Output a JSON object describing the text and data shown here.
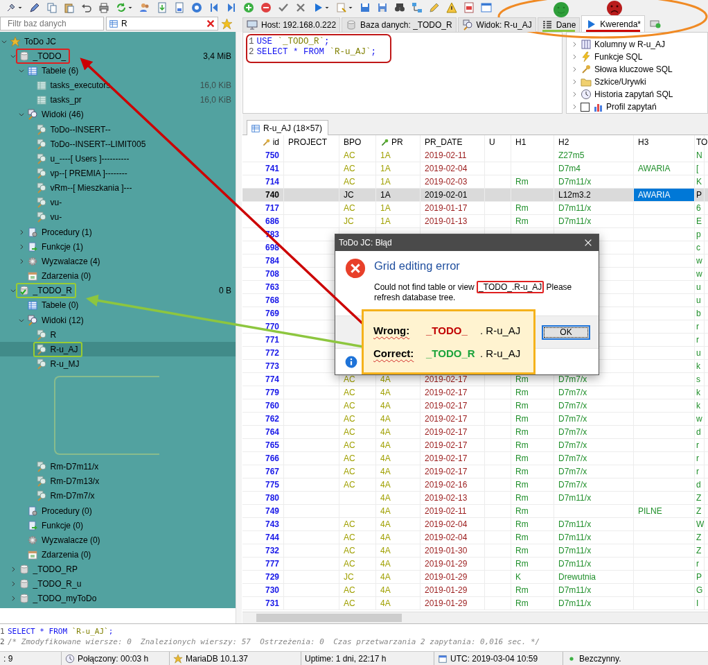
{
  "filters": {
    "database_filter": {
      "placeholder": "Filtr baz danych"
    },
    "table_filter": {
      "value": "R"
    }
  },
  "tabs": [
    {
      "label": "Host: 192.168.0.222",
      "kind": "host",
      "selected": false
    },
    {
      "label": "Baza danych: _TODO_R",
      "kind": "database",
      "selected": false
    },
    {
      "label": "Widok: R-u_AJ",
      "kind": "view",
      "selected": false
    },
    {
      "label": "Dane",
      "kind": "data",
      "selected": false,
      "color": "#8dc63f"
    },
    {
      "label": "Kwerenda*",
      "kind": "query",
      "selected": true,
      "color": "#cc0000"
    }
  ],
  "tree": [
    {
      "label": "ToDo JC",
      "kind": "server",
      "expanded": true,
      "selected": false,
      "children": [
        {
          "label": "_TODO_",
          "kind": "database",
          "size": "3,4 MiB",
          "active": false,
          "color": "#e02020",
          "expanded": true,
          "selected": false,
          "children": [
            {
              "label": "Tabele (6)",
              "kind": "tables",
              "expanded": true,
              "selected": false,
              "children": [
                {
                  "label": "tasks_executors",
                  "kind": "table",
                  "size": "16,0 KiB",
                  "selected": false
                },
                {
                  "label": "tasks_pr",
                  "kind": "table",
                  "size": "16,0 KiB",
                  "selected": false
                }
              ]
            },
            {
              "label": "Widoki (46)",
              "kind": "views",
              "expanded": true,
              "selected": false,
              "children": [
                {
                  "label": "ToDo--INSERT--",
                  "kind": "view",
                  "selected": false
                },
                {
                  "label": "ToDo--INSERT--LIMIT005",
                  "kind": "view",
                  "selected": false
                },
                {
                  "label": "u_----[ Users ]----------",
                  "kind": "view",
                  "selected": false
                },
                {
                  "label": "vp--[ PREMIA ]--------",
                  "kind": "view",
                  "selected": false
                },
                {
                  "label": "vRm--[ Mieszkania ]---",
                  "kind": "view",
                  "selected": false
                },
                {
                  "label": "vu-",
                  "kind": "view",
                  "selected": false
                },
                {
                  "label": "vu-",
                  "kind": "view",
                  "selected": false
                }
              ]
            },
            {
              "label": "Procedury (1)",
              "kind": "procedures",
              "expanded": false,
              "selected": false
            },
            {
              "label": "Funkcje (1)",
              "kind": "functions",
              "expanded": false,
              "selected": false
            },
            {
              "label": "Wyzwalacze (4)",
              "kind": "triggers",
              "expanded": false,
              "selected": false
            },
            {
              "label": "Zdarzenia (0)",
              "kind": "events",
              "selected": false
            }
          ]
        },
        {
          "label": "_TODO_R",
          "kind": "database",
          "size": "0 B",
          "active": true,
          "color": "#9acd32",
          "expanded": true,
          "selected": false,
          "children": [
            {
              "label": "Tabele (0)",
              "kind": "tables",
              "selected": false
            },
            {
              "label": "Widoki (12)",
              "kind": "views",
              "expanded": true,
              "selected": false,
              "children": [
                {
                  "label": "R",
                  "kind": "view",
                  "selected": false
                },
                {
                  "label": "R-u_AJ",
                  "kind": "view",
                  "selected": true,
                  "color": "#9acd32"
                },
                {
                  "label": "R-u_MJ",
                  "kind": "view",
                  "selected": false
                },
                {
                  "kind": "redacted"
                },
                {
                  "label": "Rm-D7m11/x",
                  "kind": "view",
                  "selected": false
                },
                {
                  "label": "Rm-D7m13/x",
                  "kind": "view",
                  "selected": false
                },
                {
                  "label": "Rm-D7m7/x",
                  "kind": "view",
                  "selected": false
                }
              ]
            },
            {
              "label": "Procedury (0)",
              "kind": "procedures",
              "selected": false
            },
            {
              "label": "Funkcje (0)",
              "kind": "functions",
              "selected": false
            },
            {
              "label": "Wyzwalacze (0)",
              "kind": "triggers",
              "selected": false
            },
            {
              "label": "Zdarzenia (0)",
              "kind": "events",
              "selected": false
            }
          ]
        },
        {
          "label": "_TODO_RP",
          "kind": "database",
          "active": false,
          "expanded": false,
          "selected": false
        },
        {
          "label": "_TODO_R_u",
          "kind": "database",
          "active": false,
          "expanded": false,
          "selected": false
        },
        {
          "label": "_TODO_myToDo",
          "kind": "database",
          "active": false,
          "expanded": false,
          "selected": false
        }
      ]
    }
  ],
  "editor": {
    "lines": [
      {
        "number": "1",
        "tokens": [
          {
            "kind": "keyword",
            "text": "USE "
          },
          {
            "kind": "string",
            "text": "`_TODO_R`"
          },
          {
            "kind": "punct",
            "text": ";"
          }
        ]
      },
      {
        "number": "2",
        "tokens": [
          {
            "kind": "keyword",
            "text": "SELECT * FROM "
          },
          {
            "kind": "string",
            "text": "`R-u_AJ`"
          },
          {
            "kind": "punct",
            "text": ";"
          }
        ]
      }
    ]
  },
  "helpers": [
    {
      "label": "Kolumny w R-u_AJ",
      "kind": "columns",
      "expanded": false
    },
    {
      "label": "Funkcje SQL",
      "kind": "functions",
      "expanded": false
    },
    {
      "label": "Słowa kluczowe SQL",
      "kind": "keywords",
      "expanded": false
    },
    {
      "label": "Szkice/Urywki",
      "kind": "snippets",
      "expanded": false
    },
    {
      "label": "Historia zapytań SQL",
      "kind": "history",
      "expanded": false
    },
    {
      "label": "Profil zapytań",
      "kind": "profile",
      "expanded": false,
      "checked": false
    }
  ],
  "result_tabs": [
    {
      "label": "R-u_AJ (18×57)",
      "selected": true
    }
  ],
  "grid": {
    "columns": [
      {
        "label": "id",
        "kind": "primary_key"
      },
      {
        "label": "PROJECT",
        "kind": "plain"
      },
      {
        "label": "BPO",
        "kind": "plain"
      },
      {
        "label": "PR",
        "kind": "foreign_key"
      },
      {
        "label": "PR_DATE",
        "kind": "plain"
      },
      {
        "label": "U",
        "kind": "plain"
      },
      {
        "label": "H1",
        "kind": "plain"
      },
      {
        "label": "H2",
        "kind": "plain"
      },
      {
        "label": "H3",
        "kind": "plain"
      },
      {
        "label": "TO",
        "kind": "plain"
      }
    ],
    "rows": [
      {
        "id": "750",
        "bpo": "AC",
        "pr": "1A",
        "pr_date": "2019-02-11",
        "h2": "Z27m5",
        "column_10": "N",
        "selected": false
      },
      {
        "id": "741",
        "bpo": "AC",
        "pr": "1A",
        "pr_date": "2019-02-04",
        "h2": "D7m4",
        "h3": "AWARIA",
        "column_10": "[",
        "selected": false
      },
      {
        "id": "714",
        "bpo": "AC",
        "pr": "1A",
        "pr_date": "2019-02-03",
        "h1": "Rm",
        "h2": "D7m11/x",
        "column_10": "K",
        "selected": false
      },
      {
        "id": "740",
        "bpo": "JC",
        "pr": "1A",
        "pr_date": "2019-02-01",
        "h2": "L12m3.2",
        "h3": {
          "text": "AWARIA",
          "focused": true
        },
        "column_10": "P",
        "selected": true
      },
      {
        "id": "717",
        "bpo": "AC",
        "pr": "1A",
        "pr_date": "2019-01-17",
        "h1": "Rm",
        "h2": "D7m11/x",
        "column_10": "6",
        "selected": false
      },
      {
        "id": "686",
        "bpo": "JC",
        "pr": "1A",
        "pr_date": "2019-01-13",
        "h1": "Rm",
        "h2": "D7m11/x",
        "column_10": "E",
        "selected": false
      },
      {
        "id": "783",
        "column_10": "p",
        "selected": false
      },
      {
        "id": "698",
        "column_10": "c",
        "selected": false
      },
      {
        "id": "784",
        "column_10": "w",
        "selected": false
      },
      {
        "id": "708",
        "column_10": "w",
        "selected": false
      },
      {
        "id": "763",
        "column_10": "u",
        "selected": false
      },
      {
        "id": "768",
        "column_10": "u",
        "selected": false
      },
      {
        "id": "769",
        "column_10": "b",
        "selected": false
      },
      {
        "id": "770",
        "column_10": "r",
        "selected": false
      },
      {
        "id": "771",
        "column_10": "r",
        "selected": false
      },
      {
        "id": "772",
        "column_10": "u",
        "selected": false
      },
      {
        "id": "773",
        "column_10": "k",
        "selected": false
      },
      {
        "id": "774",
        "bpo": "AC",
        "pr": "4A",
        "pr_date": "2019-02-17",
        "h1": "Rm",
        "h2": "D7m7/x",
        "column_10": "s",
        "selected": false
      },
      {
        "id": "779",
        "bpo": "AC",
        "pr": "4A",
        "pr_date": "2019-02-17",
        "h1": "Rm",
        "h2": "D7m7/x",
        "column_10": "k",
        "selected": false
      },
      {
        "id": "760",
        "bpo": "AC",
        "pr": "4A",
        "pr_date": "2019-02-17",
        "h1": "Rm",
        "h2": "D7m7/x",
        "column_10": "k",
        "selected": false
      },
      {
        "id": "762",
        "bpo": "AC",
        "pr": "4A",
        "pr_date": "2019-02-17",
        "h1": "Rm",
        "h2": "D7m7/x",
        "column_10": "w",
        "selected": false
      },
      {
        "id": "764",
        "bpo": "AC",
        "pr": "4A",
        "pr_date": "2019-02-17",
        "h1": "Rm",
        "h2": "D7m7/x",
        "column_10": "d",
        "selected": false
      },
      {
        "id": "765",
        "bpo": "AC",
        "pr": "4A",
        "pr_date": "2019-02-17",
        "h1": "Rm",
        "h2": "D7m7/x",
        "column_10": "r",
        "selected": false
      },
      {
        "id": "766",
        "bpo": "AC",
        "pr": "4A",
        "pr_date": "2019-02-17",
        "h1": "Rm",
        "h2": "D7m7/x",
        "column_10": "r",
        "selected": false
      },
      {
        "id": "767",
        "bpo": "AC",
        "pr": "4A",
        "pr_date": "2019-02-17",
        "h1": "Rm",
        "h2": "D7m7/x",
        "column_10": "r",
        "selected": false
      },
      {
        "id": "775",
        "bpo": "AC",
        "pr": "4A",
        "pr_date": "2019-02-16",
        "h1": "Rm",
        "h2": "D7m7/x",
        "column_10": "d",
        "selected": false
      },
      {
        "id": "780",
        "pr": "4A",
        "pr_date": "2019-02-13",
        "h1": "Rm",
        "h2": "D7m11/x",
        "column_10": "Z",
        "selected": false
      },
      {
        "id": "749",
        "pr": "4A",
        "pr_date": "2019-02-11",
        "h1": "Rm",
        "h3": "PILNE",
        "column_10": "Z",
        "selected": false
      },
      {
        "id": "743",
        "bpo": "AC",
        "pr": "4A",
        "pr_date": "2019-02-04",
        "h1": "Rm",
        "h2": "D7m11/x",
        "column_10": "W",
        "selected": false
      },
      {
        "id": "744",
        "bpo": "AC",
        "pr": "4A",
        "pr_date": "2019-02-04",
        "h1": "Rm",
        "h2": "D7m11/x",
        "column_10": "Z",
        "selected": false
      },
      {
        "id": "732",
        "bpo": "AC",
        "pr": "4A",
        "pr_date": "2019-01-30",
        "h1": "Rm",
        "h2": "D7m11/x",
        "column_10": "Z",
        "selected": false
      },
      {
        "id": "777",
        "bpo": "AC",
        "pr": "4A",
        "pr_date": "2019-01-29",
        "h1": "Rm",
        "h2": "D7m11/x",
        "column_10": "r",
        "selected": false
      },
      {
        "id": "729",
        "bpo": "JC",
        "pr": "4A",
        "pr_date": "2019-01-29",
        "h1": "K",
        "h2": "Drewutnia",
        "column_10": "P",
        "selected": false
      },
      {
        "id": "730",
        "bpo": "AC",
        "pr": "4A",
        "pr_date": "2019-01-29",
        "h1": "Rm",
        "h2": "D7m11/x",
        "column_10": "G",
        "selected": false
      },
      {
        "id": "731",
        "bpo": "AC",
        "pr": "4A",
        "pr_date": "2019-01-29",
        "h1": "Rm",
        "h2": "D7m11/x",
        "column_10": "I",
        "selected": false
      }
    ]
  },
  "dialog": {
    "title": "ToDo JC: Błąd",
    "heading": "Grid editing error",
    "message": {
      "before": "Could not find table or view",
      "highlight": "_TODO_.R-u_AJ",
      "after": "Please refresh database tree."
    },
    "button": {
      "label": "OK",
      "focused": true
    }
  },
  "annotation": {
    "lines": [
      {
        "kind": "wrong",
        "label": "Wrong:",
        "database": "_TODO_",
        "object": ". R-u_AJ"
      },
      {
        "kind": "correct",
        "label": "Correct:",
        "database": "_TODO_R",
        "object": ". R-u_AJ"
      }
    ]
  },
  "log": [
    {
      "number": "1",
      "tokens": [
        {
          "kind": "keyword",
          "text": "SELECT * FROM "
        },
        {
          "kind": "string",
          "text": "`R-u_AJ`"
        },
        {
          "kind": "punct",
          "text": ";"
        }
      ]
    },
    {
      "number": "2",
      "tokens": [
        {
          "kind": "comment",
          "text": "/* Zmodyfikowane wiersze: 0  Znalezionych wierszy: 57  Ostrzeżenia: 0  Czas przetwarzania 2 zapytania: 0,016 sec. */"
        }
      ]
    }
  ],
  "status_bar": [
    {
      "text": ": 9"
    },
    {
      "text": "Połączony: 00:03 h",
      "kind": "clock"
    },
    {
      "text": "MariaDB 10.1.37",
      "kind": "server"
    },
    {
      "text": "Uptime: 1 dni, 22:17 h"
    },
    {
      "text": "UTC: 2019-03-04 10:59",
      "kind": "calendar"
    },
    {
      "text": "Bezczynny.",
      "kind": "idle"
    }
  ]
}
